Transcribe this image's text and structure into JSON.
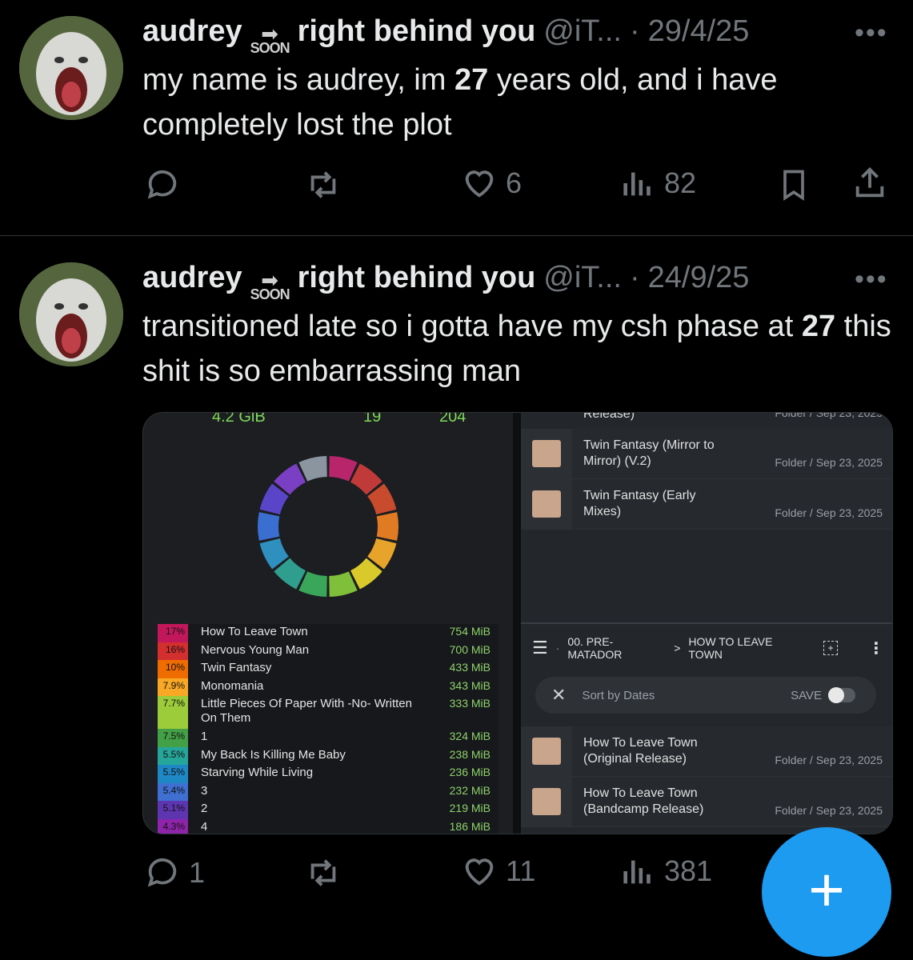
{
  "posts": [
    {
      "display_name": "audrey",
      "badge_text": "SOON",
      "name_suffix": "right behind you",
      "handle": "@iT...",
      "dot": "·",
      "date": "29/4/25",
      "more": "•••",
      "text_before": "my name is audrey, im ",
      "text_bold": "27",
      "text_after": " years old, and i have completely lost the plot",
      "replies": "",
      "reposts": "",
      "likes": "6",
      "views": "82"
    },
    {
      "display_name": "audrey",
      "badge_text": "SOON",
      "name_suffix": "right behind you",
      "handle": "@iT...",
      "dot": "·",
      "date": "24/9/25",
      "more": "•••",
      "text_before": "transitioned late so i gotta have my csh phase at ",
      "text_bold": "27",
      "text_after": " this shit is so embarrassing man",
      "replies": "1",
      "reposts": "",
      "likes": "11",
      "views": "381"
    }
  ],
  "media_left": {
    "top_stats": [
      "4.2 GiB",
      "19",
      "204"
    ],
    "donut_colors": [
      "#b8256b",
      "#c13a3a",
      "#c94b2d",
      "#e07b23",
      "#e8a42a",
      "#d9c92a",
      "#7fbf3a",
      "#3aa65a",
      "#2f9e8f",
      "#2f8fbf",
      "#3a6fd1",
      "#5a45c9",
      "#7a3fc2",
      "#8a95a0"
    ],
    "rows": [
      {
        "pct": "17%",
        "name": "How To Leave Town",
        "size": "754 MiB",
        "color": "#c2185b"
      },
      {
        "pct": "16%",
        "name": "Nervous Young Man",
        "size": "700 MiB",
        "color": "#d32f2f"
      },
      {
        "pct": "10%",
        "name": "Twin Fantasy",
        "size": "433 MiB",
        "color": "#ef6c00"
      },
      {
        "pct": "7.9%",
        "name": "Monomania",
        "size": "343 MiB",
        "color": "#f9a825"
      },
      {
        "pct": "7.7%",
        "name": "Little Pieces Of Paper With -No- Written On Them",
        "size": "333 MiB",
        "color": "#9ccc3a"
      },
      {
        "pct": "7.5%",
        "name": "1",
        "size": "324 MiB",
        "color": "#43a047"
      },
      {
        "pct": "5.5%",
        "name": "My Back Is Killing Me Baby",
        "size": "238 MiB",
        "color": "#26a69a"
      },
      {
        "pct": "5.5%",
        "name": "Starving While Living",
        "size": "236 MiB",
        "color": "#1e88c5"
      },
      {
        "pct": "5.4%",
        "name": "3",
        "size": "232 MiB",
        "color": "#3f6fd1"
      },
      {
        "pct": "5.1%",
        "name": "2",
        "size": "219 MiB",
        "color": "#5e35b1"
      },
      {
        "pct": "4.3%",
        "name": "4",
        "size": "186 MiB",
        "color": "#8e24aa"
      }
    ]
  },
  "media_right": {
    "top_partial_title": "Release)",
    "top_partial_meta": "Folder / Sep 23, 2025",
    "top_folders": [
      {
        "title": "Twin Fantasy (Mirror to Mirror) (V.2)",
        "meta": "Folder / Sep 23, 2025"
      },
      {
        "title": "Twin Fantasy (Early Mixes)",
        "meta": "Folder / Sep 23, 2025"
      }
    ],
    "breadcrumb_sep": "·",
    "breadcrumb_1": "00. PRE-MATADOR",
    "breadcrumb_arrow": ">",
    "breadcrumb_2": "HOW TO LEAVE TOWN",
    "sort_label": "Sort by Dates",
    "save_label": "SAVE",
    "bottom_folders": [
      {
        "title": "How To Leave Town (Original Release)",
        "meta": "Folder / Sep 23, 2025"
      },
      {
        "title": "How To Leave Town (Bandcamp Release)",
        "meta": "Folder / Sep 23, 2025"
      }
    ]
  },
  "fab": {
    "label": "+"
  },
  "colors": {
    "accent": "#1d9bf0",
    "muted": "#71767b",
    "text": "#e7e9ea"
  }
}
